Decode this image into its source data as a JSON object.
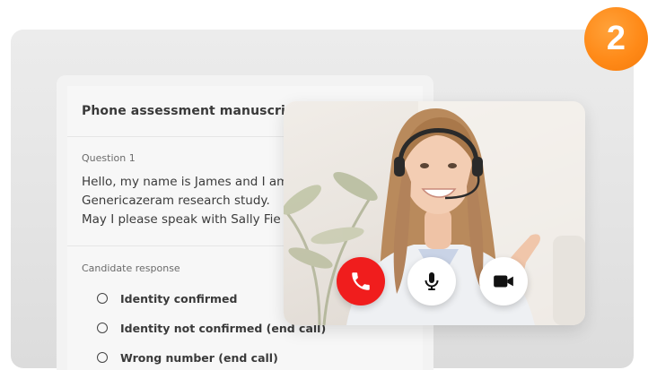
{
  "step_badge": "2",
  "manuscript": {
    "title": "Phone assessment manuscript",
    "question_label": "Question 1",
    "question_lines": [
      "Hello, my name is James and I am",
      "Genericazeram research study.",
      "May I please speak with Sally Fie"
    ],
    "response_label": "Candidate response",
    "options": [
      "Identity confirmed",
      "Identity not confirmed (end call)",
      "Wrong number (end call)"
    ]
  },
  "call_controls": {
    "end_call_color": "#f01d1d",
    "buttons": [
      "phone-hangup-icon",
      "microphone-icon",
      "video-camera-icon"
    ]
  },
  "colors": {
    "accent_badge": "#ff8a18",
    "background": "#e8e8e8"
  }
}
